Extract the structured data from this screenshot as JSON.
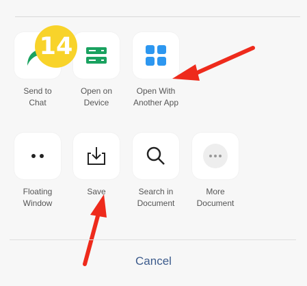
{
  "badge": {
    "number": "14"
  },
  "row1": [
    {
      "name": "send-to-chat-button",
      "icon": "send-arrow-icon",
      "label": "Send to\nChat"
    },
    {
      "name": "open-on-device-button",
      "icon": "device-icon",
      "label": "Open on\nDevice"
    },
    {
      "name": "open-with-another-app-button",
      "icon": "grid-apps-icon",
      "label": "Open With\nAnother App"
    }
  ],
  "row2": [
    {
      "name": "floating-window-button",
      "icon": "dots-icon",
      "label": "Floating\nWindow"
    },
    {
      "name": "save-button",
      "icon": "download-tray-icon",
      "label": "Save"
    },
    {
      "name": "search-in-document-button",
      "icon": "search-icon",
      "label": "Search in\nDocument"
    },
    {
      "name": "more-document-button",
      "icon": "more-dots-icon",
      "label": "More\nDocument"
    }
  ],
  "footer": {
    "cancel_label": "Cancel"
  },
  "colors": {
    "accent_green": "#1aa260",
    "accent_blue": "#2d97f0",
    "arrow_red": "#ee2b1c",
    "badge_yellow": "#f8d32a",
    "cancel_blue": "#3c5b8c"
  }
}
